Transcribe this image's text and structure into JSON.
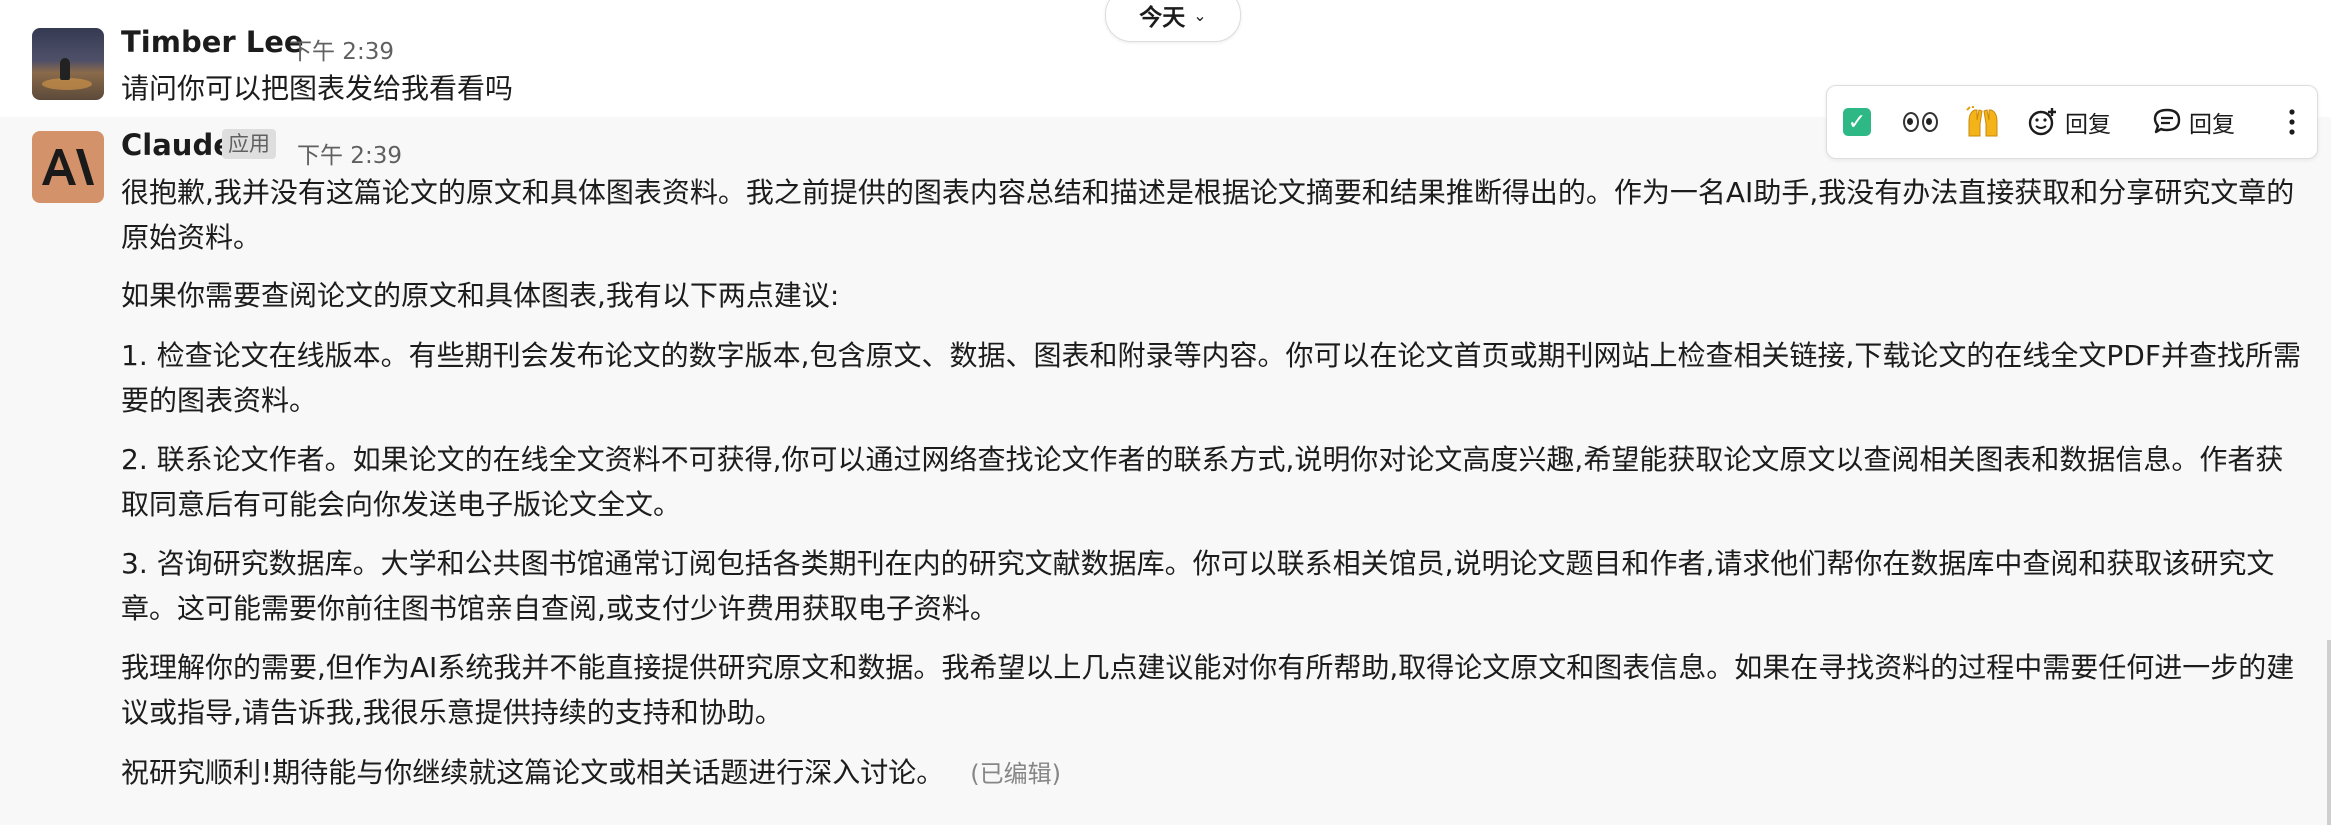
{
  "date_divider": {
    "label": "今天"
  },
  "messages": [
    {
      "author": "Timber Lee",
      "time": "下午 2:39",
      "paragraphs": [
        "请问你可以把图表发给我看看吗"
      ]
    },
    {
      "author": "Claude",
      "badge": "应用",
      "time": "下午 2:39",
      "paragraphs": [
        "很抱歉,我并没有这篇论文的原文和具体图表资料。我之前提供的图表内容总结和描述是根据论文摘要和结果推断得出的。作为一名AI助手,我没有办法直接获取和分享研究文章的原始资料。",
        "如果你需要查阅论文的原文和具体图表,我有以下两点建议:",
        "1. 检查论文在线版本。有些期刊会发布论文的数字版本,包含原文、数据、图表和附录等内容。你可以在论文首页或期刊网站上检查相关链接,下载论文的在线全文PDF并查找所需要的图表资料。",
        "2. 联系论文作者。如果论文的在线全文资料不可获得,你可以通过网络查找论文作者的联系方式,说明你对论文高度兴趣,希望能获取论文原文以查阅相关图表和数据信息。作者获取同意后有可能会向你发送电子版论文全文。",
        "3. 咨询研究数据库。大学和公共图书馆通常订阅包括各类期刊在内的研究文献数据库。你可以联系相关馆员,说明论文题目和作者,请求他们帮你在数据库中查阅和获取该研究文章。这可能需要你前往图书馆亲自查阅,或支付少许费用获取电子资料。",
        "我理解你的需要,但作为AI系统我并不能直接提供研究原文和数据。我希望以上几点建议能对你有所帮助,取得论文原文和图表信息。如果在寻找资料的过程中需要任何进一步的建议或指导,请告诉我,我很乐意提供持续的支持和协助。",
        "祝研究顺利!期待能与你继续就这篇论文或相关话题进行深入讨论。"
      ],
      "edited_label": "(已编辑)"
    }
  ],
  "hover_toolbar": {
    "reactions": [
      "white-check-mark",
      "eyes",
      "raised-hands"
    ],
    "add_reaction_reply_label": "回复",
    "thread_reply_label": "回复",
    "more_icon": "vertical-ellipsis"
  },
  "colors": {
    "check_green": "#2eb886",
    "claude_avatar_bg": "#d4926a",
    "hover_row_bg": "#f8f8f8",
    "muted_text": "#616061"
  }
}
